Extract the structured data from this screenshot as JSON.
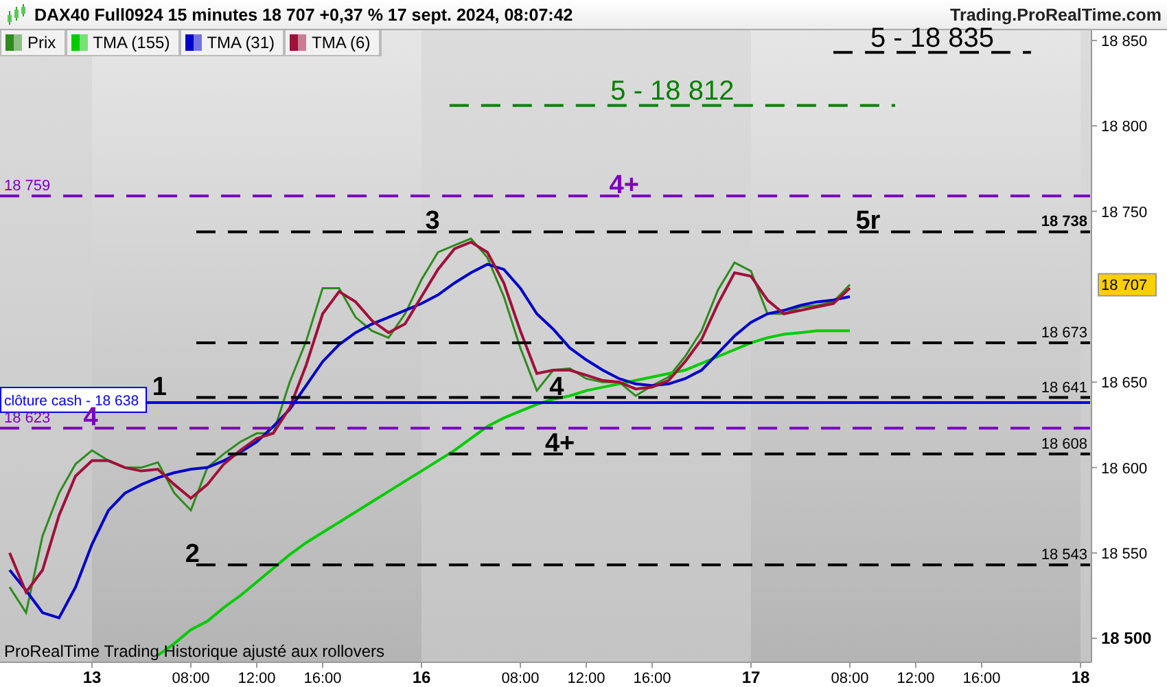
{
  "header": {
    "title": "DAX40 Full0924 15 minutes 18 707 +0,37 % 17 sept. 2024, 08:07:42",
    "site": "Trading.ProRealTime.com"
  },
  "chart": {
    "footnote": "ProRealTime Trading Historique ajusté aux rollovers",
    "last_price": "18 707",
    "levels": [
      {
        "label": "5 - 18 835",
        "color": "#000000"
      },
      {
        "label": "5 - 18 812",
        "color": "#008000"
      },
      {
        "label": "18 759",
        "color": "#7a00c0"
      },
      {
        "label": "18 738",
        "color": "#000000"
      },
      {
        "label": "18 673",
        "color": "#000000"
      },
      {
        "label": "18 641",
        "color": "#000000"
      },
      {
        "label": "clôture cash -  18 638",
        "color": "#0000ee"
      },
      {
        "label": "18 623",
        "color": "#7a00c0"
      },
      {
        "label": "18 608",
        "color": "#000000"
      },
      {
        "label": "18 543",
        "color": "#000000"
      }
    ],
    "wave_labels": [
      {
        "text": "4+",
        "color": "#7a00c0"
      },
      {
        "text": "3",
        "color": "#000000"
      },
      {
        "text": "5r",
        "color": "#000000"
      },
      {
        "text": "1",
        "color": "#000000"
      },
      {
        "text": "4",
        "color": "#000000"
      },
      {
        "text": "4",
        "color": "#7a00c0"
      },
      {
        "text": "4+",
        "color": "#000000"
      },
      {
        "text": "2",
        "color": "#000000"
      }
    ],
    "chart_data": {
      "type": "line",
      "categories": [
        null,
        null,
        null,
        null,
        null,
        "13",
        null,
        null,
        null,
        null,
        null,
        "08:00",
        null,
        null,
        null,
        "12:00",
        null,
        null,
        null,
        "16:00",
        null,
        null,
        null,
        null,
        null,
        "16",
        null,
        null,
        null,
        null,
        null,
        "08:00",
        null,
        null,
        null,
        "12:00",
        null,
        null,
        null,
        "16:00",
        null,
        null,
        null,
        null,
        null,
        "17",
        null,
        null,
        null,
        null,
        null,
        "08:00",
        null,
        null,
        null,
        "12:00",
        null,
        null,
        null,
        "16:00",
        null,
        null,
        null,
        null,
        null,
        "18"
      ],
      "series": [
        {
          "name": "Prix",
          "color": "#2e8b1e",
          "values": [
            18530,
            18515,
            18560,
            18585,
            18602,
            18610,
            18604,
            18600,
            18600,
            18603,
            18585,
            18575,
            18600,
            18608,
            18615,
            18620,
            18620,
            18650,
            18674,
            18705,
            18705,
            18688,
            18680,
            18676,
            18690,
            18710,
            18726,
            18730,
            18734,
            18723,
            18700,
            18670,
            18645,
            18657,
            18658,
            18652,
            18650,
            18650,
            18642,
            18648,
            18653,
            18665,
            18680,
            18704,
            18720,
            18715,
            18690,
            18690,
            18694,
            18695,
            18697,
            18707,
            null,
            null,
            null,
            null,
            null,
            null,
            null,
            null,
            null,
            null,
            null,
            null,
            null,
            null
          ]
        },
        {
          "name": "TMA (155)",
          "color": "#00cc00",
          "values": [
            null,
            null,
            null,
            null,
            null,
            null,
            null,
            null,
            null,
            18490,
            18497,
            18505,
            18510,
            18518,
            18525,
            18533,
            18541,
            18549,
            18556,
            18562,
            18568,
            18574,
            18580,
            18586,
            18592,
            18598,
            18604,
            18610,
            18617,
            18624,
            18629,
            18633,
            18637,
            18640,
            18642,
            18645,
            18647,
            18649,
            18651,
            18653,
            18655,
            18657,
            18661,
            18665,
            18669,
            18673,
            18676,
            18678,
            18679,
            18680,
            18680,
            18680,
            null,
            null,
            null,
            null,
            null,
            null,
            null,
            null,
            null,
            null,
            null,
            null,
            null,
            null
          ]
        },
        {
          "name": "TMA (31)",
          "color": "#0000cc",
          "values": [
            18540,
            18528,
            18515,
            18512,
            18530,
            18555,
            18575,
            18585,
            18590,
            18594,
            18597,
            18599,
            18600,
            18604,
            18609,
            18615,
            18624,
            18634,
            18648,
            18662,
            18672,
            18679,
            18684,
            18688,
            18692,
            18696,
            18701,
            18708,
            18714,
            18719,
            18716,
            18705,
            18690,
            18681,
            18670,
            18663,
            18657,
            18652,
            18649,
            18648,
            18649,
            18652,
            18657,
            18667,
            18677,
            18685,
            18690,
            18692,
            18695,
            18697,
            18698,
            18700,
            null,
            null,
            null,
            null,
            null,
            null,
            null,
            null,
            null,
            null,
            null,
            null,
            null,
            null
          ]
        },
        {
          "name": "TMA (6)",
          "color": "#a0103a",
          "values": [
            18550,
            18527,
            18540,
            18572,
            18595,
            18604,
            18604,
            18600,
            18598,
            18599,
            18590,
            18582,
            18590,
            18602,
            18610,
            18617,
            18620,
            18635,
            18660,
            18690,
            18703,
            18697,
            18686,
            18679,
            18684,
            18700,
            18716,
            18728,
            18732,
            18726,
            18708,
            18680,
            18655,
            18657,
            18657,
            18654,
            18651,
            18650,
            18646,
            18647,
            18651,
            18662,
            18675,
            18696,
            18714,
            18712,
            18698,
            18690,
            18692,
            18694,
            18696,
            18705,
            null,
            null,
            null,
            null,
            null,
            null,
            null,
            null,
            null,
            null,
            null,
            null,
            null,
            null
          ]
        }
      ],
      "ylim": [
        18486,
        18856
      ],
      "yticks": [
        {
          "value": 18500,
          "label": "18 500"
        },
        {
          "value": 18550,
          "label": "18 550"
        },
        {
          "value": 18600,
          "label": "18 600"
        },
        {
          "value": 18650,
          "label": "18 650"
        },
        {
          "value": 18750,
          "label": "18 750"
        },
        {
          "value": 18800,
          "label": "18 800"
        },
        {
          "value": 18850,
          "label": "18 850"
        }
      ]
    }
  }
}
